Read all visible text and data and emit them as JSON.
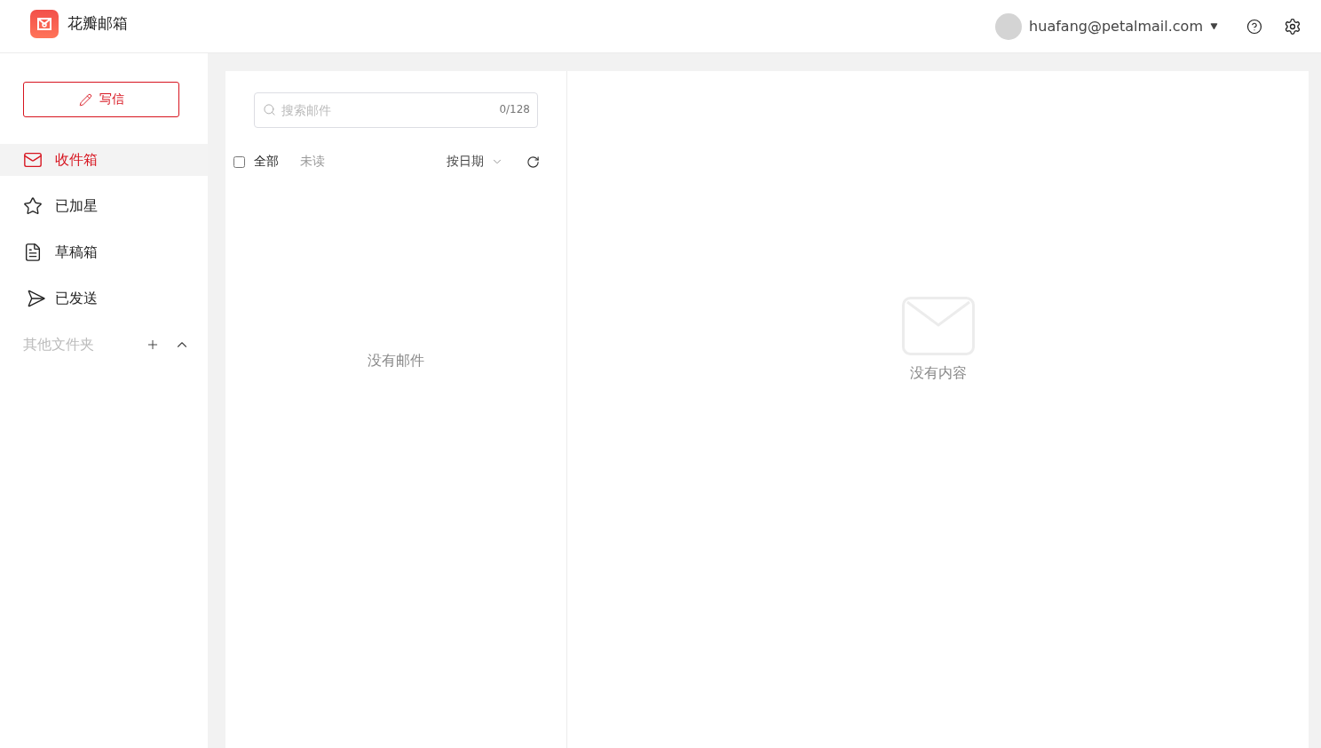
{
  "app": {
    "name": "花瓣邮箱"
  },
  "account": {
    "email": "huafang@petalmail.com"
  },
  "compose": {
    "label": "写信"
  },
  "sidebar": {
    "items": [
      {
        "kind": "inbox",
        "label": "收件箱",
        "selected": true
      },
      {
        "kind": "star",
        "label": "已加星",
        "selected": false
      },
      {
        "kind": "draft",
        "label": "草稿箱",
        "selected": false
      },
      {
        "kind": "sent",
        "label": "已发送",
        "selected": false
      }
    ],
    "section": {
      "label": "其他文件夹",
      "expanded": true
    }
  },
  "search": {
    "placeholder": "搜索邮件",
    "counter": "0/128"
  },
  "list_toolbar": {
    "select_all_checked": false,
    "filters": [
      {
        "label": "全部",
        "selected": true
      },
      {
        "label": "未读",
        "selected": false
      }
    ],
    "sort": "按日期"
  },
  "list": {
    "empty_text": "没有邮件"
  },
  "reader": {
    "empty_text": "没有内容"
  }
}
